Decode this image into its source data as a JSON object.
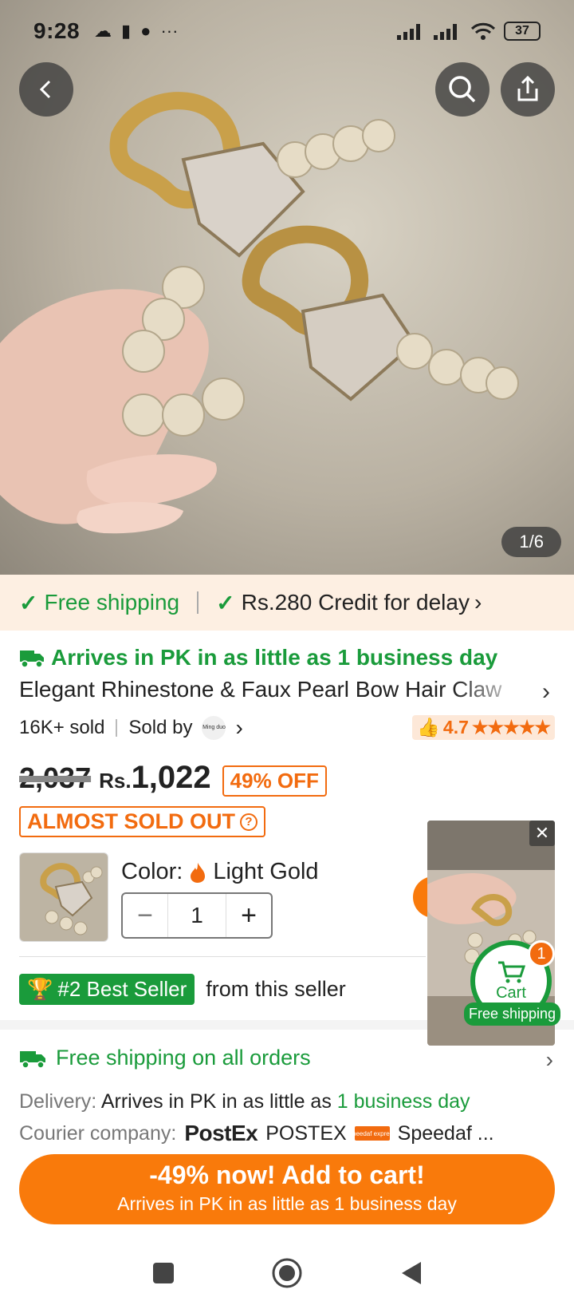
{
  "status": {
    "time": "9:28",
    "battery": "37"
  },
  "gallery": {
    "counter": "1/6"
  },
  "banner": {
    "free_shipping": "Free shipping",
    "credit": "Rs.280 Credit for delay"
  },
  "product": {
    "arrives": "Arrives in PK in as little as 1 business day",
    "title": "Elegant Rhinestone & Faux Pearl Bow Hair Claw",
    "sold": "16K+ sold",
    "sold_by": "Sold by",
    "seller_logo": "Ming duo",
    "rating": "4.7",
    "stars": "★★★★★",
    "old_price": "2,037",
    "currency": "Rs.",
    "price": "1,022",
    "discount": "49% OFF",
    "almost_sold_out": "ALMOST SOLD OUT",
    "color_label": "Color:",
    "color_value": "Light Gold",
    "quantity": "1",
    "best_seller_badge": "#2 Best Seller",
    "best_seller_suffix": "from this seller"
  },
  "shipping": {
    "heading": "Free shipping on all orders",
    "delivery_label": "Delivery:",
    "delivery_text": "Arrives in PK in as little as ",
    "delivery_highlight": "1 business day",
    "courier_label": "Courier company:",
    "courier_logo_1": "PostEx",
    "courier_1": "POSTEX",
    "courier_logo_2": "Speedaf express",
    "courier_2": "Speedaf ..."
  },
  "floating_cart": {
    "label": "Cart",
    "count": "1",
    "free": "Free shipping"
  },
  "cta": {
    "line1": "-49% now! Add to cart!",
    "line2": "Arrives in PK in as little as 1 business day"
  },
  "colors": {
    "green": "#1a9b3b",
    "orange": "#f97a0b",
    "banner_bg": "#fdefe2"
  }
}
